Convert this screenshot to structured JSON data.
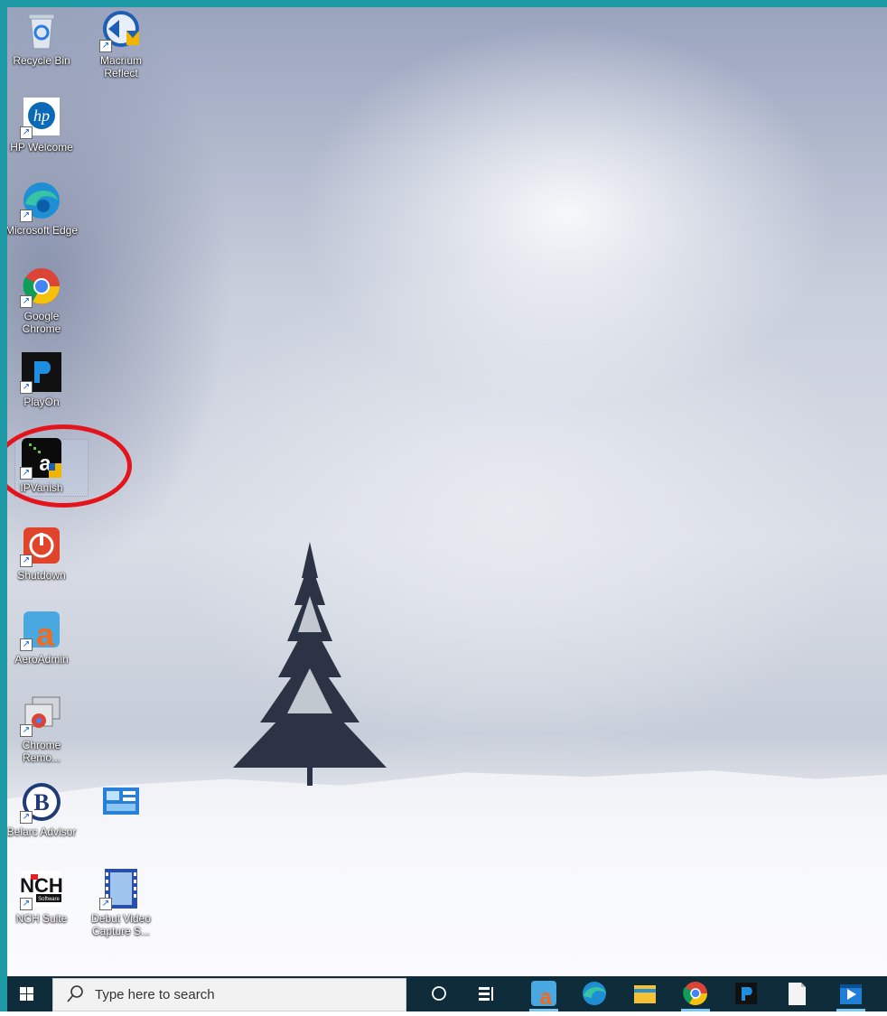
{
  "desktop": {
    "icons": [
      {
        "label": "Recycle Bin",
        "icon": "recycle-bin-icon"
      },
      {
        "label": "Macrium Reflect",
        "icon": "macrium-reflect-icon"
      },
      {
        "label": "HP Welcome",
        "icon": "hp-welcome-icon"
      },
      {
        "label": "Microsoft Edge",
        "icon": "edge-icon"
      },
      {
        "label": "Google Chrome",
        "icon": "chrome-icon"
      },
      {
        "label": "PlayOn",
        "icon": "playon-icon"
      },
      {
        "label": "IPVanish",
        "icon": "ipvanish-icon"
      },
      {
        "label": "Shutdown",
        "icon": "shutdown-icon"
      },
      {
        "label": "AeroAdmin",
        "icon": "aeroadmin-icon"
      },
      {
        "label": "Chrome Remo...",
        "icon": "chrome-remote-desktop-icon"
      },
      {
        "label": "Belarc Advisor",
        "icon": "belarc-advisor-icon"
      },
      {
        "label": "NCH Suite",
        "icon": "nch-suite-icon"
      },
      {
        "label": "Debut Video Capture S...",
        "icon": "debut-video-capture-icon"
      }
    ],
    "highlight_color": "#e4141c"
  },
  "taskbar": {
    "search_placeholder": "Type here to search",
    "pinned": [
      "cortana-icon",
      "task-view-icon",
      "aeroadmin-icon",
      "edge-icon",
      "file-explorer-icon",
      "chrome-icon",
      "playon-icon",
      "notepad-icon",
      "movies-tv-icon"
    ]
  }
}
